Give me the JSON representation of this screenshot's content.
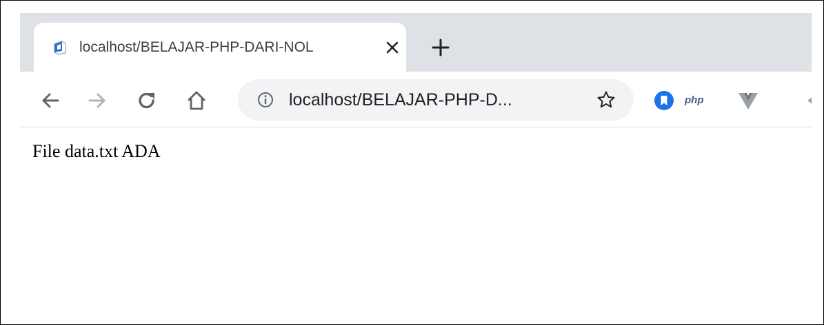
{
  "browser": {
    "tab": {
      "title": "localhost/BELAJAR-PHP-DARI-NOL",
      "favicon": "page-favicon-icon",
      "close_icon": "close-icon"
    },
    "new_tab_icon": "plus-icon",
    "toolbar": {
      "back_icon": "arrow-left-icon",
      "forward_icon": "arrow-right-icon",
      "reload_icon": "reload-icon",
      "home_icon": "home-icon",
      "site_info_icon": "info-icon",
      "url": "localhost/BELAJAR-PHP-D...",
      "bookmark_icon": "star-icon"
    },
    "extensions": [
      {
        "name": "bookmark-extension-icon",
        "color": "#1a73e8"
      },
      {
        "name": "php-extension-icon",
        "label": "php",
        "color": "#4f5b93"
      },
      {
        "name": "vue-devtools-icon",
        "color": "#9aa0a6"
      }
    ]
  },
  "page": {
    "text": "File data.txt ADA"
  },
  "colors": {
    "tabstrip": "#dee1e6",
    "omnibox": "#f1f3f4",
    "icon": "#5f6368",
    "icon_disabled": "#b0b3b8"
  }
}
